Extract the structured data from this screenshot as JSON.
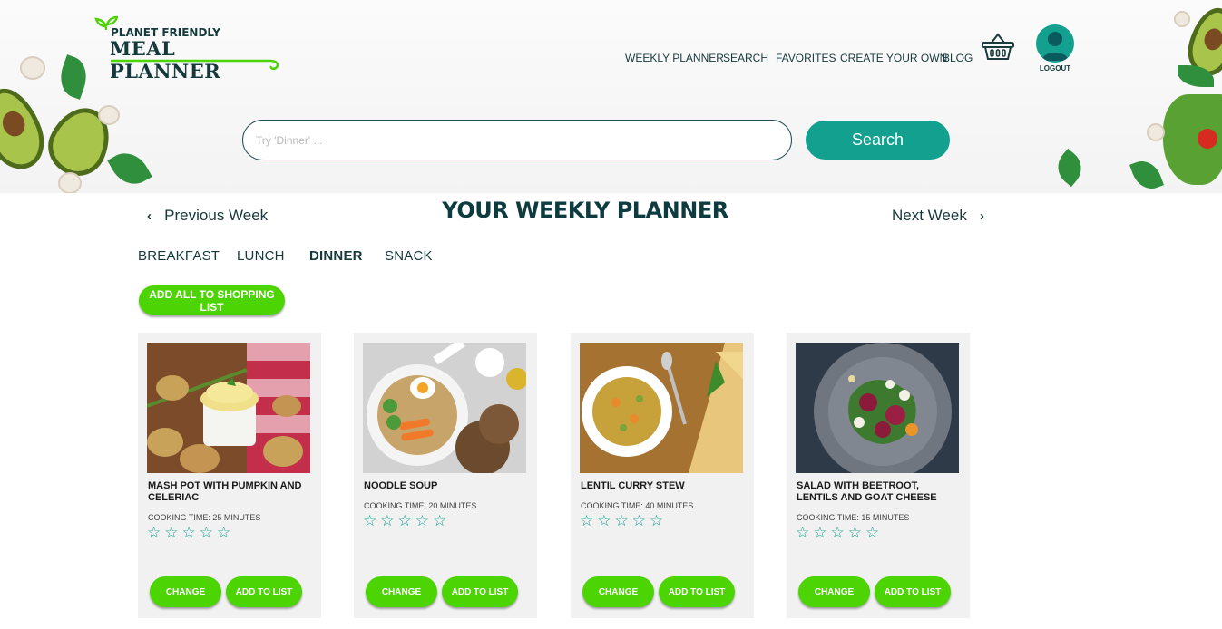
{
  "header": {
    "logo_line1": "PLANET FRIENDLY",
    "logo_line2": "MEAL PLANNER",
    "nav": [
      "WEEKLY PLANNER",
      "SEARCH",
      "FAVORITES",
      "CREATE YOUR OWN",
      "BLOG"
    ],
    "logout_label": "LOGOUT"
  },
  "search": {
    "placeholder": "Try 'Dinner' ...",
    "button_label": "Search"
  },
  "planner": {
    "title": "YOUR WEEKLY PLANNER",
    "prev_label": "Previous Week",
    "next_label": "Next Week",
    "tabs": [
      "BREAKFAST",
      "LUNCH",
      "DINNER",
      "SNACK"
    ],
    "active_tab": "DINNER",
    "add_all_label": "ADD ALL TO SHOPPING LIST"
  },
  "cards": [
    {
      "title": "MASH POT WITH PUMPKIN AND CELERIAC",
      "time": "COOKING TIME: 25 MINUTES",
      "stars": "☆☆☆☆☆",
      "change": "CHANGE",
      "add": "ADD TO LIST"
    },
    {
      "title": "NOODLE SOUP",
      "time": "COOKING TIME: 20 MINUTES",
      "stars": "☆☆☆☆☆",
      "change": "CHANGE",
      "add": "ADD TO LIST"
    },
    {
      "title": "LENTIL CURRY STEW",
      "time": "COOKING TIME: 40 MINUTES",
      "stars": "☆☆☆☆☆",
      "change": "CHANGE",
      "add": "ADD TO LIST"
    },
    {
      "title": "SALAD WITH BEETROOT, LENTILS AND GOAT CHEESE",
      "time": "COOKING TIME: 15 MINUTES",
      "stars": "☆☆☆☆☆",
      "change": "CHANGE",
      "add": "ADD TO LIST"
    }
  ],
  "colors": {
    "brand_teal": "#13a08f",
    "brand_green": "#4cd404",
    "dark_text": "#0d3b3f"
  },
  "icons": [
    "sprout-icon",
    "basket-icon",
    "user-avatar-icon",
    "chevron-left-icon",
    "chevron-right-icon",
    "star-icon"
  ]
}
